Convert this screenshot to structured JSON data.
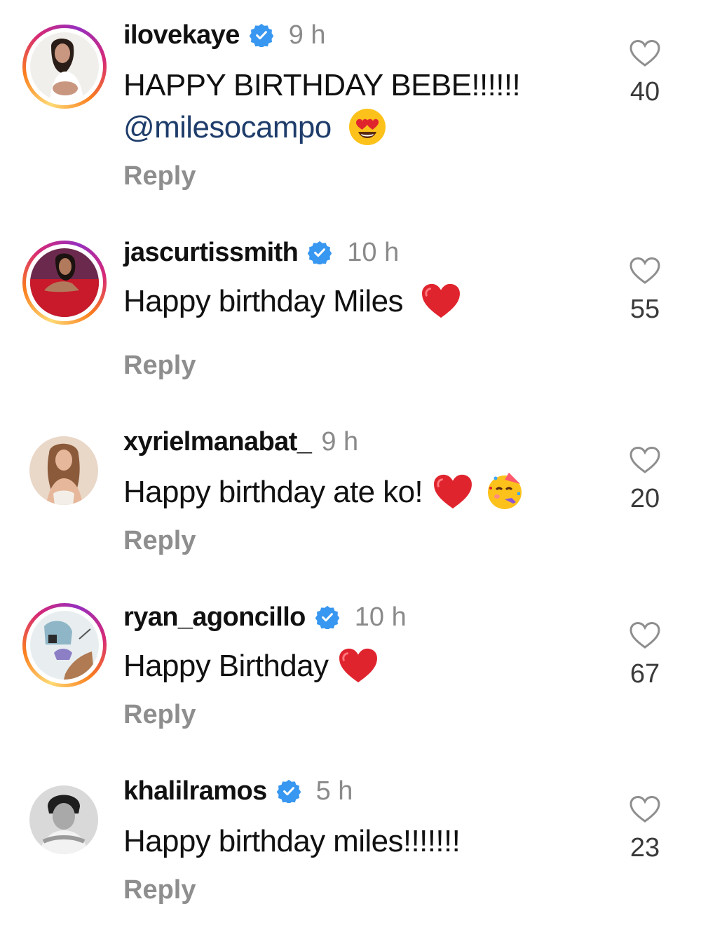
{
  "comments": [
    {
      "username": "ilovekaye",
      "verified": true,
      "time": "9 h",
      "text_line1": "HAPPY BIRTHDAY BEBE!!!!!!",
      "mention": "@milesocampo",
      "emoji": "heart-eyes-emoji",
      "reply": "Reply",
      "likes": "40",
      "story_ring": true
    },
    {
      "username": "jascurtissmith",
      "verified": true,
      "time": "10 h",
      "text": "Happy birthday Miles",
      "emoji": "red-heart-emoji",
      "reply": "Reply",
      "likes": "55",
      "story_ring": true
    },
    {
      "username": "xyrielmanabat_",
      "verified": false,
      "time": "9 h",
      "text": "Happy birthday ate ko!",
      "emoji": "red-heart-emoji, partying-face-emoji",
      "reply": "Reply",
      "likes": "20",
      "story_ring": false
    },
    {
      "username": "ryan_agoncillo",
      "verified": true,
      "time": "10 h",
      "text": "Happy Birthday",
      "emoji": "red-heart-emoji",
      "reply": "Reply",
      "likes": "67",
      "story_ring": true
    },
    {
      "username": "khalilramos",
      "verified": true,
      "time": "5 h",
      "text": "Happy birthday miles!!!!!!!",
      "reply": "Reply",
      "likes": "23",
      "story_ring": false
    }
  ],
  "colors": {
    "verified_blue": "#3897f0",
    "mention": "#1f3d6b",
    "muted_text": "#8e8e8e",
    "heart_red": "#e0242e"
  }
}
